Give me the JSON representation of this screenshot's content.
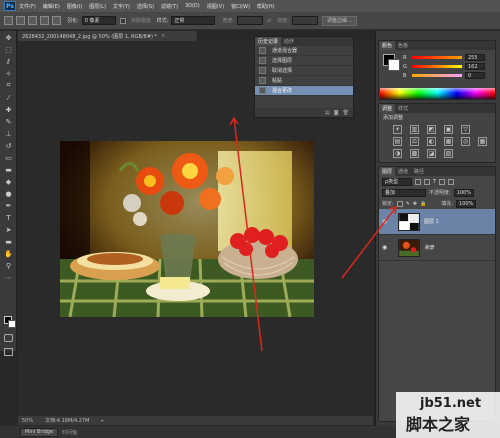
{
  "app": {
    "logo": "Ps"
  },
  "menu": [
    "文件(F)",
    "编辑(E)",
    "图像(I)",
    "图层(L)",
    "文字(Y)",
    "选择(S)",
    "滤镜(T)",
    "3D(D)",
    "视图(V)",
    "窗口(W)",
    "帮助(H)"
  ],
  "options": {
    "feather_label": "羽化:",
    "feather_value": "0 像素",
    "antialias_label": "消除锯齿",
    "style_label": "样式:",
    "style_value": "正常",
    "width_label": "宽度:",
    "height_label": "高度:",
    "refine_edge_button": "调整边缘..."
  },
  "document": {
    "tab_title": "2626432_200148048_2.jpg @ 50% (图层 1, RGB/8#) *",
    "zoom": "50%",
    "doc_size": "文档:4.18M/4.27M"
  },
  "bottom": {
    "mini_bridge": "Mini Bridge",
    "timeline": "时间轴"
  },
  "history": {
    "tabs": [
      "历史记录",
      "动作"
    ],
    "items": [
      {
        "label": "通道混合器"
      },
      {
        "label": "选择图层"
      },
      {
        "label": "取消选择"
      },
      {
        "label": "粘贴"
      },
      {
        "label": "混合更改",
        "selected": true
      }
    ]
  },
  "color_panel": {
    "tabs": [
      "颜色",
      "色板"
    ],
    "sliders": [
      {
        "label": "R",
        "value": "255",
        "color": "#e23a3a"
      },
      {
        "label": "G",
        "value": "162",
        "color": "#3ae23a"
      },
      {
        "label": "B",
        "value": "0",
        "color": "#3a5ae2"
      }
    ]
  },
  "adjust_panel": {
    "tabs": [
      "调整",
      "样式"
    ],
    "title": "添加调整",
    "icons": [
      "☀",
      "▥",
      "◩",
      "▣",
      "▽",
      "",
      "▤",
      "⚖",
      "◐",
      "▦",
      "◎",
      "▦",
      "◑",
      "▩",
      "◪",
      "▧",
      "",
      ""
    ]
  },
  "layers_panel": {
    "tabs": [
      "图层",
      "通道",
      "路径"
    ],
    "kind_label": "ρ类型",
    "blend_mode": "叠加",
    "opacity_label": "不透明度:",
    "opacity_value": "100%",
    "lock_label": "锁定:",
    "fill_label": "填充:",
    "fill_value": "100%",
    "layers": [
      {
        "name": "图层 1",
        "selected": true,
        "italic": false
      },
      {
        "name": "背景",
        "selected": false,
        "italic": true
      }
    ]
  },
  "watermark": {
    "line1": "jb51.net",
    "line2": "脚本之家"
  }
}
